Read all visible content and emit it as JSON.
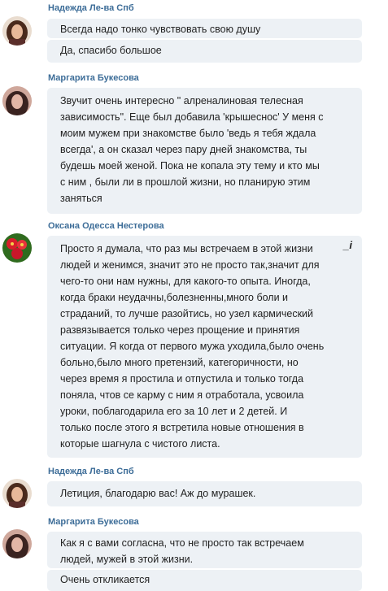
{
  "messages": [
    {
      "author": "Надежда Ле-ва Спб",
      "avatar": "avatar-nadezhda",
      "parts": [
        {
          "lines": [
            "Всегда надо тонко чувствовать свою душу"
          ]
        },
        {
          "lines": [
            "Да, спасибо большое"
          ]
        }
      ]
    },
    {
      "author": "Маргарита Букесова",
      "avatar": "avatar-margarita",
      "parts": [
        {
          "lines": [
            "Звучит очень интересно \" алреналиновая телесная",
            "зависимость\". Еще был добавила 'крышеснос' У меня с",
            "моим мужем при знакомстве было 'ведь я тебя ждала",
            "всегда', а он сказал через пару дней знакомства, ты",
            "будешь моей женой. Пока не копала эту тему и кто мы",
            "с ним , были ли в прошлой жизни, но планирую этим",
            "заняться"
          ]
        }
      ]
    },
    {
      "author": "Оксана Одесса Нестерова",
      "avatar": "avatar-oksana",
      "parts": [
        {
          "lines": [
            "Просто я думала, что раз мы встречаем в этой жизни",
            "людей и женимся, значит это не просто так,значит для",
            "чего-то они нам нужны, для какого-то опыта. Иногда,",
            "когда браки неудачны,болезненны,много боли и",
            "страданий, то лучше разойтись, но узел кармический",
            "развязывается только через прощение и принятия",
            "ситуации. Я когда от первого мужа уходила,было очень",
            "больно,было много претензий, категоричности, но",
            "через время я простила и отпустила и только тогда",
            "поняла, чтов се карму с ним я отработала, усвоила",
            "уроки, поблагодарила его за 10 лет и 2 детей. И",
            "только после этого я встретила новые отношения в",
            "которые шагнула с чистого листа."
          ]
        }
      ],
      "corner_icon": "_i"
    },
    {
      "author": "Надежда Ле-ва Спб",
      "avatar": "avatar-nadezhda",
      "parts": [
        {
          "lines": [
            "Летиция, благодарю вас! Аж до мурашек."
          ]
        }
      ]
    },
    {
      "author": "Маргарита Букесова",
      "avatar": "avatar-margarita",
      "parts": [
        {
          "lines": [
            "Как я с вами согласна, что не просто так встречаем",
            "людей, мужей в этой жизни."
          ]
        },
        {
          "lines": [
            "Очень откликается"
          ]
        }
      ]
    }
  ]
}
